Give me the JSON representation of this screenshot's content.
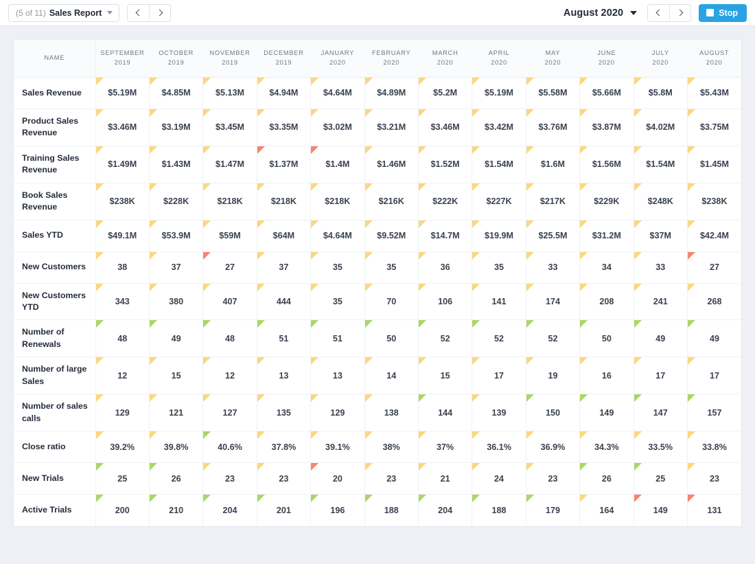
{
  "toolbar": {
    "report_counter": "(5 of 11)",
    "report_name": "Sales Report",
    "dropdown_icon": "chevron-down-icon",
    "prev_report_icon": "chevron-left-icon",
    "next_report_icon": "chevron-right-icon",
    "period_label": "August 2020",
    "period_dropdown_icon": "chevron-down-icon",
    "prev_period_icon": "chevron-left-icon",
    "next_period_icon": "chevron-right-icon",
    "stop_label": "Stop",
    "stop_icon": "stop-square-icon",
    "stop_color": "#29a3e3"
  },
  "colors": {
    "flag_yellow": "#fbd77f",
    "flag_green": "#a9d765",
    "flag_red": "#f8836f",
    "accent": "#29a3e3"
  },
  "table": {
    "name_header": "NAME",
    "columns": [
      {
        "month": "SEPTEMBER",
        "year": "2019"
      },
      {
        "month": "OCTOBER",
        "year": "2019"
      },
      {
        "month": "NOVEMBER",
        "year": "2019"
      },
      {
        "month": "DECEMBER",
        "year": "2019"
      },
      {
        "month": "JANUARY",
        "year": "2020"
      },
      {
        "month": "FEBRUARY",
        "year": "2020"
      },
      {
        "month": "MARCH",
        "year": "2020"
      },
      {
        "month": "APRIL",
        "year": "2020"
      },
      {
        "month": "MAY",
        "year": "2020"
      },
      {
        "month": "JUNE",
        "year": "2020"
      },
      {
        "month": "JULY",
        "year": "2020"
      },
      {
        "month": "AUGUST",
        "year": "2020"
      }
    ],
    "rows": [
      {
        "label": "Sales Revenue",
        "values": [
          "$5.19M",
          "$4.85M",
          "$5.13M",
          "$4.94M",
          "$4.64M",
          "$4.89M",
          "$5.2M",
          "$5.19M",
          "$5.58M",
          "$5.66M",
          "$5.8M",
          "$5.43M"
        ],
        "flags": [
          "yellow",
          "yellow",
          "yellow",
          "yellow",
          "yellow",
          "yellow",
          "yellow",
          "yellow",
          "yellow",
          "yellow",
          "yellow",
          "yellow"
        ]
      },
      {
        "label": "Product Sales Revenue",
        "values": [
          "$3.46M",
          "$3.19M",
          "$3.45M",
          "$3.35M",
          "$3.02M",
          "$3.21M",
          "$3.46M",
          "$3.42M",
          "$3.76M",
          "$3.87M",
          "$4.02M",
          "$3.75M"
        ],
        "flags": [
          "yellow",
          "yellow",
          "yellow",
          "yellow",
          "yellow",
          "yellow",
          "yellow",
          "yellow",
          "yellow",
          "yellow",
          "yellow",
          "yellow"
        ]
      },
      {
        "label": "Training Sales Revenue",
        "values": [
          "$1.49M",
          "$1.43M",
          "$1.47M",
          "$1.37M",
          "$1.4M",
          "$1.46M",
          "$1.52M",
          "$1.54M",
          "$1.6M",
          "$1.56M",
          "$1.54M",
          "$1.45M"
        ],
        "flags": [
          "yellow",
          "yellow",
          "yellow",
          "red",
          "red",
          "yellow",
          "yellow",
          "yellow",
          "yellow",
          "yellow",
          "yellow",
          "yellow"
        ]
      },
      {
        "label": "Book Sales Revenue",
        "values": [
          "$238K",
          "$228K",
          "$218K",
          "$218K",
          "$218K",
          "$216K",
          "$222K",
          "$227K",
          "$217K",
          "$229K",
          "$248K",
          "$238K"
        ],
        "flags": [
          "yellow",
          "yellow",
          "yellow",
          "yellow",
          "yellow",
          "yellow",
          "yellow",
          "yellow",
          "yellow",
          "yellow",
          "yellow",
          "yellow"
        ]
      },
      {
        "label": "Sales YTD",
        "values": [
          "$49.1M",
          "$53.9M",
          "$59M",
          "$64M",
          "$4.64M",
          "$9.52M",
          "$14.7M",
          "$19.9M",
          "$25.5M",
          "$31.2M",
          "$37M",
          "$42.4M"
        ],
        "flags": [
          "yellow",
          "yellow",
          "yellow",
          "yellow",
          "yellow",
          "yellow",
          "yellow",
          "yellow",
          "yellow",
          "yellow",
          "yellow",
          "yellow"
        ]
      },
      {
        "label": "New Customers",
        "values": [
          "38",
          "37",
          "27",
          "37",
          "35",
          "35",
          "36",
          "35",
          "33",
          "34",
          "33",
          "27"
        ],
        "flags": [
          "yellow",
          "yellow",
          "red",
          "yellow",
          "yellow",
          "yellow",
          "yellow",
          "yellow",
          "yellow",
          "yellow",
          "yellow",
          "red"
        ]
      },
      {
        "label": "New Customers YTD",
        "values": [
          "343",
          "380",
          "407",
          "444",
          "35",
          "70",
          "106",
          "141",
          "174",
          "208",
          "241",
          "268"
        ],
        "flags": [
          "yellow",
          "yellow",
          "yellow",
          "yellow",
          "yellow",
          "yellow",
          "yellow",
          "yellow",
          "yellow",
          "yellow",
          "yellow",
          "yellow"
        ]
      },
      {
        "label": "Number of Renewals",
        "values": [
          "48",
          "49",
          "48",
          "51",
          "51",
          "50",
          "52",
          "52",
          "52",
          "50",
          "49",
          "49"
        ],
        "flags": [
          "green",
          "green",
          "green",
          "green",
          "green",
          "green",
          "green",
          "green",
          "green",
          "green",
          "green",
          "green"
        ]
      },
      {
        "label": "Number of large Sales",
        "values": [
          "12",
          "15",
          "12",
          "13",
          "13",
          "14",
          "15",
          "17",
          "19",
          "16",
          "17",
          "17"
        ],
        "flags": [
          "yellow",
          "yellow",
          "yellow",
          "yellow",
          "yellow",
          "yellow",
          "yellow",
          "yellow",
          "yellow",
          "yellow",
          "yellow",
          "yellow"
        ]
      },
      {
        "label": "Number of sales calls",
        "values": [
          "129",
          "121",
          "127",
          "135",
          "129",
          "138",
          "144",
          "139",
          "150",
          "149",
          "147",
          "157"
        ],
        "flags": [
          "yellow",
          "yellow",
          "yellow",
          "yellow",
          "yellow",
          "yellow",
          "green",
          "yellow",
          "green",
          "green",
          "green",
          "green"
        ]
      },
      {
        "label": "Close ratio",
        "values": [
          "39.2%",
          "39.8%",
          "40.6%",
          "37.8%",
          "39.1%",
          "38%",
          "37%",
          "36.1%",
          "36.9%",
          "34.3%",
          "33.5%",
          "33.8%"
        ],
        "flags": [
          "yellow",
          "yellow",
          "green",
          "yellow",
          "yellow",
          "yellow",
          "yellow",
          "yellow",
          "yellow",
          "yellow",
          "yellow",
          "yellow"
        ]
      },
      {
        "label": "New Trials",
        "values": [
          "25",
          "26",
          "23",
          "23",
          "20",
          "23",
          "21",
          "24",
          "23",
          "26",
          "25",
          "23"
        ],
        "flags": [
          "green",
          "green",
          "yellow",
          "yellow",
          "red",
          "yellow",
          "yellow",
          "yellow",
          "yellow",
          "green",
          "green",
          "yellow"
        ]
      },
      {
        "label": "Active Trials",
        "values": [
          "200",
          "210",
          "204",
          "201",
          "196",
          "188",
          "204",
          "188",
          "179",
          "164",
          "149",
          "131"
        ],
        "flags": [
          "green",
          "green",
          "green",
          "green",
          "green",
          "green",
          "green",
          "green",
          "green",
          "yellow",
          "red",
          "red"
        ]
      }
    ]
  }
}
